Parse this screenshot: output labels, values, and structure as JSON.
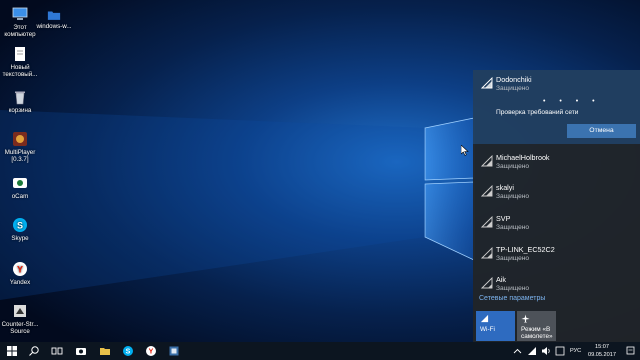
{
  "desktop": {
    "icons": [
      {
        "label": "Этот компьютер",
        "icon": "computer-icon"
      },
      {
        "label": "Новый текстовый...",
        "icon": "text-document-icon"
      },
      {
        "label": "корзина",
        "icon": "recycle-bin-icon"
      },
      {
        "label": "MultiPlayer [0.3.7]",
        "icon": "multiplayer-app-icon"
      },
      {
        "label": "oCam",
        "icon": "ocam-icon"
      },
      {
        "label": "Skype",
        "icon": "skype-icon"
      },
      {
        "label": "Yandex",
        "icon": "yandex-browser-icon"
      },
      {
        "label": "Counter-Str... Source",
        "icon": "counter-strike-icon"
      }
    ],
    "folder": {
      "label": "windows-w...",
      "icon": "folder-icon"
    }
  },
  "network_flyout": {
    "networks": [
      {
        "name": "Dodonchiki",
        "status": "Защищено",
        "state": "connecting"
      },
      {
        "name": "MichaelHolbrook",
        "status": "Защищено"
      },
      {
        "name": "skalyi",
        "status": "Защищено"
      },
      {
        "name": "SVP",
        "status": "Защищено"
      },
      {
        "name": "TP-LINK_EC52C2",
        "status": "Защищено"
      },
      {
        "name": "Aik",
        "status": "Защищено"
      }
    ],
    "checking_text": "Проверка требований сети",
    "progress_dots": "• • • •",
    "cancel_label": "Отмена",
    "settings_link": "Сетевые параметры",
    "quick_actions": [
      {
        "label": "Wi-Fi",
        "icon": "wifi-icon",
        "state": "on"
      },
      {
        "label": "Режим «В самолете»",
        "icon": "airplane-icon",
        "state": "off"
      }
    ]
  },
  "taskbar": {
    "items": [
      "start-button",
      "search-icon",
      "task-view-icon",
      "camera-app-icon",
      "explorer-icon",
      "skype-icon",
      "yandex-icon",
      "app-icon"
    ],
    "language": "РУС",
    "time": "15:07",
    "date": "09.05.2017"
  },
  "colors": {
    "accent": "#2e6bc0",
    "flyout_bg": "#202429",
    "link": "#7cb3ee"
  }
}
